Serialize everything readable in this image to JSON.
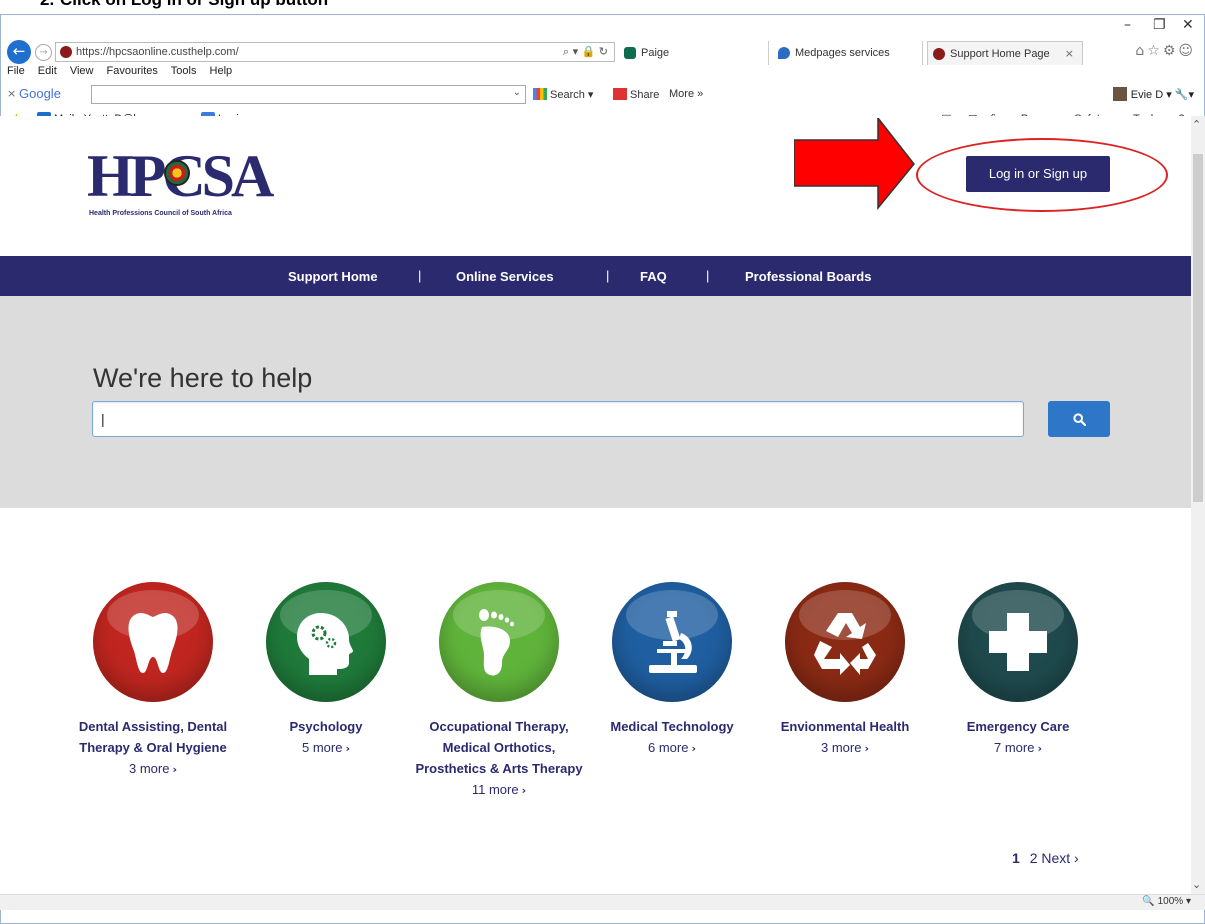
{
  "caption": {
    "number": "2.",
    "text": "Click on Log in or Sign up button"
  },
  "browser": {
    "url": "https://hpcsaonline.custhelp.com/",
    "tabs": [
      {
        "label": "Paige"
      },
      {
        "label": "Medpages services"
      },
      {
        "label": "Support Home Page"
      }
    ],
    "menu": [
      "File",
      "Edit",
      "View",
      "Favourites",
      "Tools",
      "Help"
    ],
    "google": {
      "logo": "Google",
      "search_label": "Search",
      "share_label": "Share",
      "more_label": "More »",
      "user": "Evie D"
    },
    "favourites": [
      {
        "label": "Mail - YvetteD@hpcsa.co"
      },
      {
        "label": "Login"
      }
    ],
    "command_bar": [
      "Page",
      "Safety",
      "Tools"
    ],
    "zoom": "100%"
  },
  "site": {
    "logo_text": "HPCSA",
    "logo_tagline": "Health Professions Council of South Africa",
    "login_button": "Log in or Sign up",
    "nav": [
      {
        "label": "Support Home"
      },
      {
        "label": "Online Services"
      },
      {
        "label": "FAQ"
      },
      {
        "label": "Professional Boards"
      }
    ],
    "nav_separator": "|",
    "hero_title": "We're here to help",
    "search_value": "|",
    "categories": [
      {
        "title": "Dental Assisting, Dental Therapy & Oral Hygiene",
        "more": "3 more",
        "icon": "tooth-icon",
        "color": "#c0261f"
      },
      {
        "title": "Psychology",
        "more": "5 more",
        "icon": "head-gears-icon",
        "color": "#1f7a3a"
      },
      {
        "title": "Occupational Therapy, Medical Orthotics, Prosthetics & Arts Therapy",
        "more": "11 more",
        "icon": "footprint-icon",
        "color": "#5fb33a"
      },
      {
        "title": "Medical Technology",
        "more": "6 more",
        "icon": "microscope-icon",
        "color": "#1f5ea0"
      },
      {
        "title": "Envionmental Health",
        "more": "3 more",
        "icon": "recycle-icon",
        "color": "#8a2a14"
      },
      {
        "title": "Emergency Care",
        "more": "7 more",
        "icon": "cross-icon",
        "color": "#1f4a4d"
      }
    ],
    "pager": {
      "current": "1",
      "next_page": "2",
      "next_label": "Next ›"
    }
  }
}
